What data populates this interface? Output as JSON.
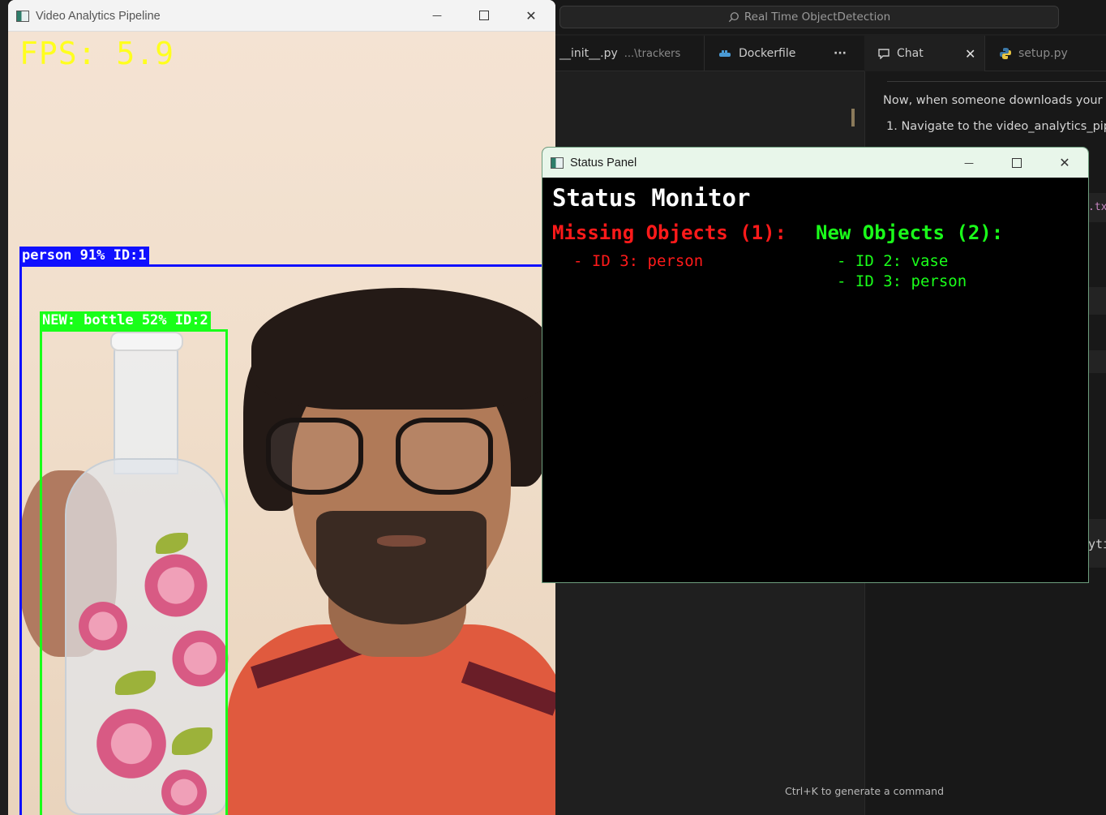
{
  "editor": {
    "command_center": "Real Time ObjectDetection",
    "tabs": [
      {
        "label": "__init__.py",
        "path": "...\\trackers"
      },
      {
        "label": "Dockerfile"
      },
      {
        "label": "···"
      },
      {
        "label": "Chat"
      },
      {
        "label": "setup.py"
      }
    ],
    "chat_lines": [
      "Now, when someone downloads your",
      "1. Navigate to the video_analytics_pipe"
    ],
    "chat_fragment_1": ".tx",
    "chat_fragment_2": "yti",
    "bottom_hint": "Ctrl+K to generate a command"
  },
  "video_window": {
    "title": "Video Analytics Pipeline",
    "fps_text": "FPS: 5.9",
    "detections": [
      {
        "label": "person 91% ID:1",
        "color": "#1010ff"
      },
      {
        "label": "NEW: bottle 52% ID:2",
        "color": "#19ff19"
      }
    ]
  },
  "status_window": {
    "title": "Status Panel",
    "heading": "Status Monitor",
    "missing": {
      "header": "Missing Objects (1):",
      "color": "#ff1a1a",
      "items": [
        "- ID 3: person"
      ]
    },
    "new": {
      "header": "New Objects (2):",
      "color": "#1aff1a",
      "items": [
        "- ID 2: vase",
        "- ID 3: person"
      ]
    }
  },
  "window_controls": {
    "minimize": "—",
    "maximize": "☐",
    "close": "✕"
  }
}
